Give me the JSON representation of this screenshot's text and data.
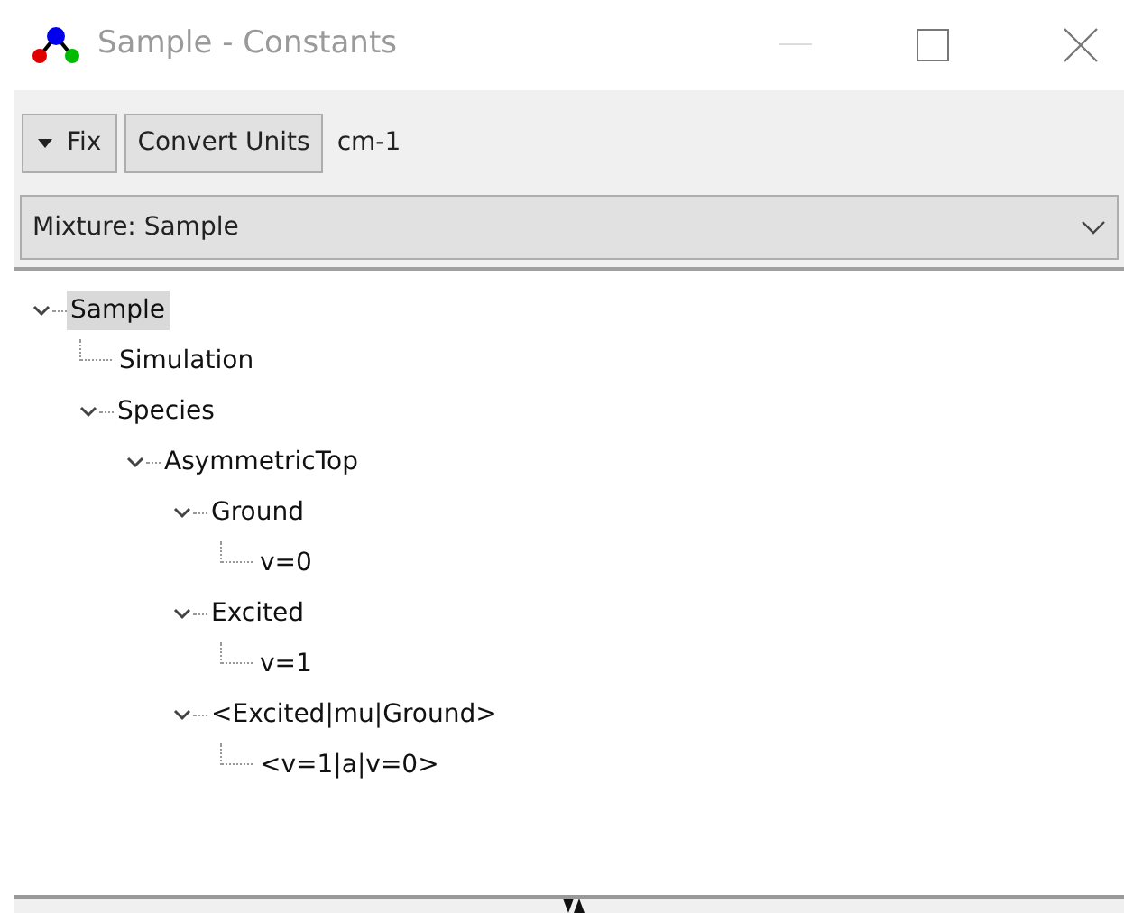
{
  "window": {
    "title": "Sample - Constants"
  },
  "toolbar": {
    "fix_button": "Fix",
    "convert_button": "Convert Units",
    "units": "cm-1"
  },
  "mixture_select": {
    "value": "Mixture: Sample"
  },
  "tree": [
    {
      "label": "Sample",
      "selected": true,
      "expanded": true,
      "children": [
        {
          "label": "Simulation",
          "selected": false
        },
        {
          "label": "Species",
          "selected": false,
          "expanded": true,
          "children": [
            {
              "label": "AsymmetricTop",
              "selected": false,
              "expanded": true,
              "children": [
                {
                  "label": "Ground",
                  "selected": false,
                  "expanded": true,
                  "children": [
                    {
                      "label": "v=0",
                      "selected": false
                    }
                  ]
                },
                {
                  "label": "Excited",
                  "selected": false,
                  "expanded": true,
                  "children": [
                    {
                      "label": "v=1",
                      "selected": false
                    }
                  ]
                },
                {
                  "label": "<Excited|mu|Ground>",
                  "selected": false,
                  "expanded": true,
                  "children": [
                    {
                      "label": "<v=1|a|v=0>",
                      "selected": false
                    }
                  ]
                }
              ]
            }
          ]
        }
      ]
    }
  ]
}
